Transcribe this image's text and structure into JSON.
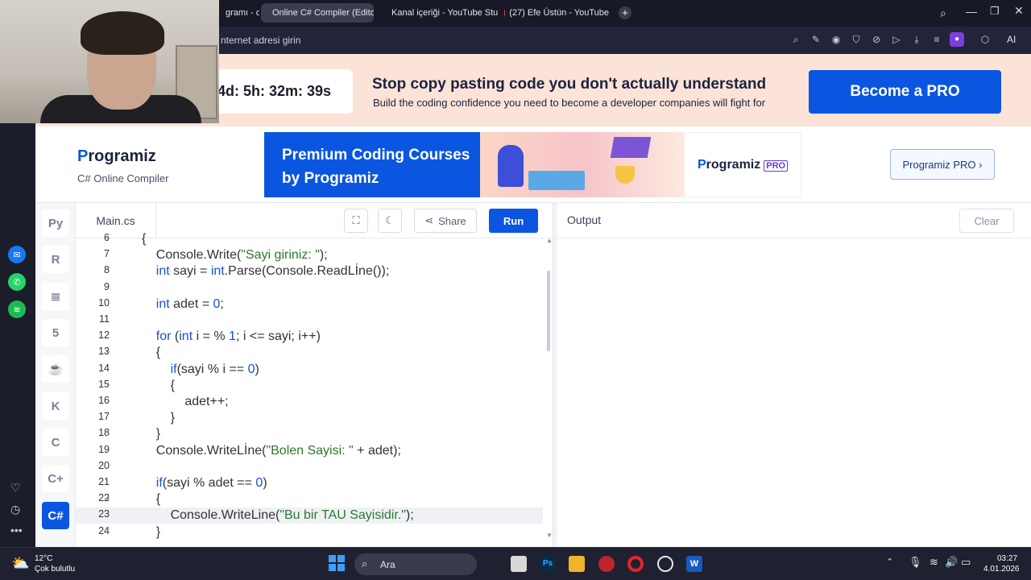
{
  "browser": {
    "tabs": [
      {
        "label": "gramı - d"
      },
      {
        "label": "Online C# Compiler (Edito"
      },
      {
        "label": "Kanal içeriği - YouTube Stu"
      },
      {
        "label": "(27) Efe Üstün - YouTube"
      }
    ],
    "address_placeholder": "nternet adresi girin",
    "ai_label": "AI"
  },
  "promo": {
    "timer": "4d: 5h: 32m: 39s",
    "headline": "Stop copy pasting code you don't actually understand",
    "subline": "Build the coding confidence you need to become a developer companies will fight for",
    "cta": "Become a PRO"
  },
  "header": {
    "logo": "rogramiz",
    "logo_p": "P",
    "subtitle": "C# Online Compiler",
    "banner_text": "Premium Coding Courses by Programiz",
    "banner_logo": "rogramiz",
    "banner_logo_p": "P",
    "banner_pro": "PRO",
    "pro_button": "Programiz PRO ›"
  },
  "editor": {
    "file_name": "Main.cs",
    "share_label": "Share",
    "run_label": "Run",
    "lines": [
      {
        "n": "6",
        "fold": true,
        "text": "{"
      },
      {
        "n": "7",
        "text": "    Console.Write(\"Sayi giriniz: \");"
      },
      {
        "n": "8",
        "text": "    int sayi = int.Parse(Console.ReadLİne());"
      },
      {
        "n": "9",
        "text": ""
      },
      {
        "n": "10",
        "text": "    int adet = 0;"
      },
      {
        "n": "11",
        "text": ""
      },
      {
        "n": "12",
        "text": "    for (int i = % 1; i <= sayi; i++)"
      },
      {
        "n": "13",
        "fold": true,
        "text": "    {"
      },
      {
        "n": "14",
        "text": "        if(sayi % i == 0)"
      },
      {
        "n": "15",
        "fold": true,
        "text": "        {"
      },
      {
        "n": "16",
        "text": "            adet++;"
      },
      {
        "n": "17",
        "text": "        }"
      },
      {
        "n": "18",
        "text": "    }"
      },
      {
        "n": "19",
        "text": "    Console.WriteLİne(\"Bolen Sayisi: \" + adet);"
      },
      {
        "n": "20",
        "text": ""
      },
      {
        "n": "21",
        "text": "    if(sayi % adet == 0)"
      },
      {
        "n": "22",
        "fold": true,
        "text": "    {"
      },
      {
        "n": "23",
        "text": "        Console.WriteLine(\"Bu bir TAU Sayisidir.\");"
      },
      {
        "n": "24",
        "text": "    }"
      }
    ]
  },
  "output": {
    "title": "Output",
    "clear_label": "Clear"
  },
  "taskbar": {
    "temp": "12°C",
    "weather": "Çok bulutlu",
    "search": "Ara",
    "time": "03:27",
    "date": "4.01.2026"
  }
}
